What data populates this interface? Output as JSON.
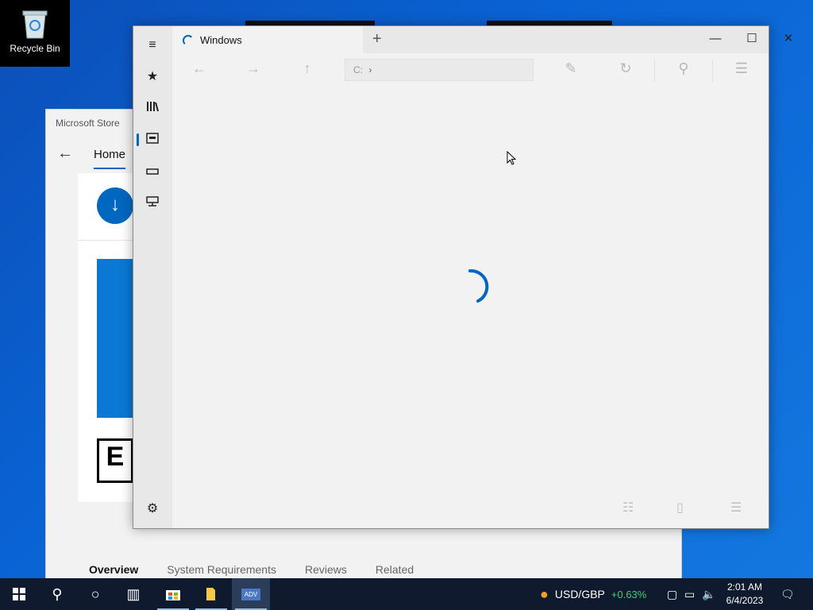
{
  "desktop": {
    "recycle_bin_label": "Recycle Bin"
  },
  "store": {
    "title": "Microsoft Store",
    "nav_home": "Home",
    "esrb_letter": "E",
    "tabs": [
      "Overview",
      "System Requirements",
      "Reviews",
      "Related"
    ],
    "accent": "#0067c0"
  },
  "files": {
    "tab_title": "Windows",
    "address_text": "C:",
    "icons": {
      "rail": [
        "hamburger-icon",
        "star-icon",
        "library-icon",
        "drives-icon",
        "drive-icon",
        "network-icon",
        "settings-icon"
      ],
      "toolbar": [
        "back-icon",
        "forward-icon",
        "up-icon",
        "rename-icon",
        "refresh-icon",
        "search-icon",
        "layout-icon"
      ],
      "bottom": [
        "select-all-icon",
        "new-item-icon",
        "list-view-icon"
      ]
    }
  },
  "taskbar": {
    "ticker_symbol": "USD/GBP",
    "ticker_change": "+0.63%",
    "time": "2:01 AM",
    "date": "6/4/2023",
    "active_app_label": "ADV"
  }
}
